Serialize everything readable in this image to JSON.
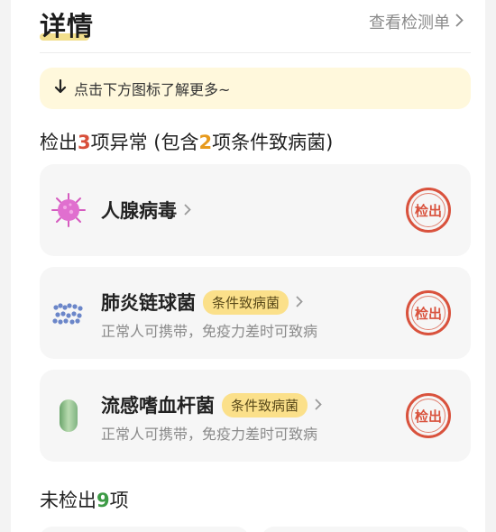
{
  "header": {
    "title": "详情",
    "view_report": "查看检测单"
  },
  "hint": {
    "text": "点击下方图标了解更多~"
  },
  "detected_summary": {
    "prefix": "检出",
    "count": "3",
    "middle": "项异常 (包含",
    "conditional_count": "2",
    "suffix": "项条件致病菌)"
  },
  "items": [
    {
      "name": "人腺病毒",
      "tag": "",
      "desc": "",
      "stamp": "检出",
      "icon": "virus-icon"
    },
    {
      "name": "肺炎链球菌",
      "tag": "条件致病菌",
      "desc": "正常人可携带，免疫力差时可致病",
      "stamp": "检出",
      "icon": "cocci-chain-icon"
    },
    {
      "name": "流感嗜血杆菌",
      "tag": "条件致病菌",
      "desc": "正常人可携带，免疫力差时可致病",
      "stamp": "检出",
      "icon": "bacillus-icon"
    }
  ],
  "not_detected_summary": {
    "prefix": "未检出",
    "count": "9",
    "suffix": "项"
  },
  "colors": {
    "accent_red": "#d84f3a",
    "accent_orange": "#e79a1d",
    "accent_green": "#3d9b46",
    "tag_bg": "#fbe08a",
    "hint_bg": "#fff8dc"
  }
}
